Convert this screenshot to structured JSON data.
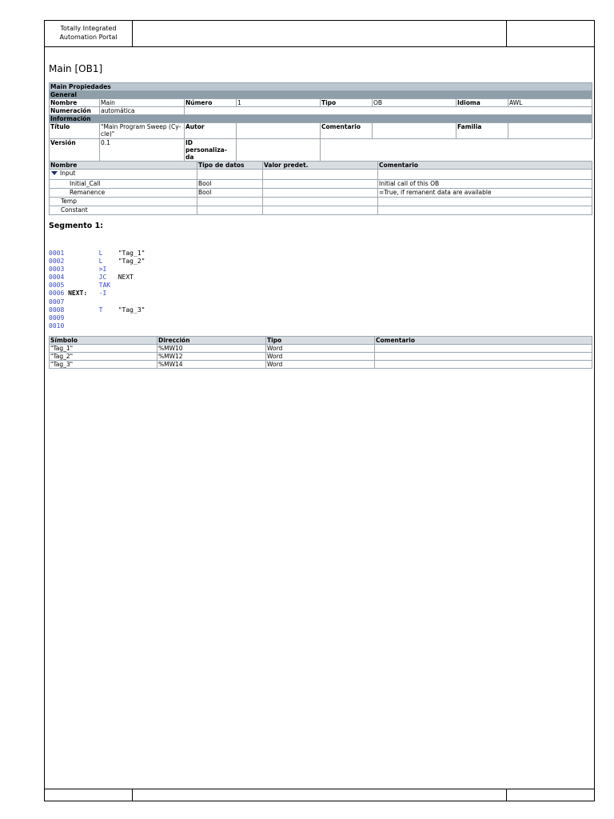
{
  "header": {
    "product": "Totally Integrated Automation Portal"
  },
  "title": "Main [OB1]",
  "properties": {
    "section": "Main Propiedades",
    "general": "General",
    "nombre_label": "Nombre",
    "nombre": "Main",
    "numero_label": "Número",
    "numero": "1",
    "tipo_label": "Tipo",
    "tipo": "OB",
    "idioma_label": "Idioma",
    "idioma": "AWL",
    "numeracion_label": "Numeración",
    "numeracion": "automática",
    "informacion": "Información",
    "titulo_label": "Título",
    "titulo": "\"Main Program Sweep (Cy-cle)\"",
    "autor_label": "Autor",
    "autor": "",
    "comentario_label": "Comentario",
    "comentario": "",
    "familia_label": "Familia",
    "familia": "",
    "version_label": "Versión",
    "version": "0.1",
    "id_label": "ID personaliza-da",
    "id": ""
  },
  "interface": {
    "headers": [
      "Nombre",
      "Tipo de datos",
      "Valor predet.",
      "Comentario"
    ],
    "rows": [
      {
        "name": "Input",
        "type": "",
        "default": "",
        "comment": ""
      },
      {
        "name": "Initial_Call",
        "type": "Bool",
        "default": "",
        "comment": "Initial call of this OB"
      },
      {
        "name": "Remanence",
        "type": "Bool",
        "default": "",
        "comment": "=True, if remanent data are available"
      },
      {
        "name": "Temp",
        "type": "",
        "default": "",
        "comment": ""
      },
      {
        "name": "Constant",
        "type": "",
        "default": "",
        "comment": ""
      }
    ]
  },
  "segment": "Segmento 1:",
  "code": [
    {
      "n": "0001",
      "label": "",
      "op": "L",
      "arg": "\"Tag_1\""
    },
    {
      "n": "0002",
      "label": "",
      "op": "L",
      "arg": "\"Tag_2\""
    },
    {
      "n": "0003",
      "label": "",
      "op": ">I",
      "arg": ""
    },
    {
      "n": "0004",
      "label": "",
      "op": "JC",
      "arg": "NEXT"
    },
    {
      "n": "0005",
      "label": "",
      "op": "TAK",
      "arg": ""
    },
    {
      "n": "0006",
      "label": "NEXT:",
      "op": "-I",
      "arg": ""
    },
    {
      "n": "0007",
      "label": "",
      "op": "",
      "arg": ""
    },
    {
      "n": "0008",
      "label": "",
      "op": "T",
      "arg": "\"Tag_3\""
    },
    {
      "n": "0009",
      "label": "",
      "op": "",
      "arg": ""
    },
    {
      "n": "0010",
      "label": "",
      "op": "",
      "arg": ""
    }
  ],
  "symbols": {
    "headers": [
      "Símbolo",
      "Dirección",
      "Tipo",
      "Comentario"
    ],
    "rows": [
      [
        "\"Tag_1\"",
        "%MW10",
        "Word",
        ""
      ],
      [
        "\"Tag_2\"",
        "%MW12",
        "Word",
        ""
      ],
      [
        "\"Tag_3\"",
        "%MW14",
        "Word",
        ""
      ]
    ]
  }
}
